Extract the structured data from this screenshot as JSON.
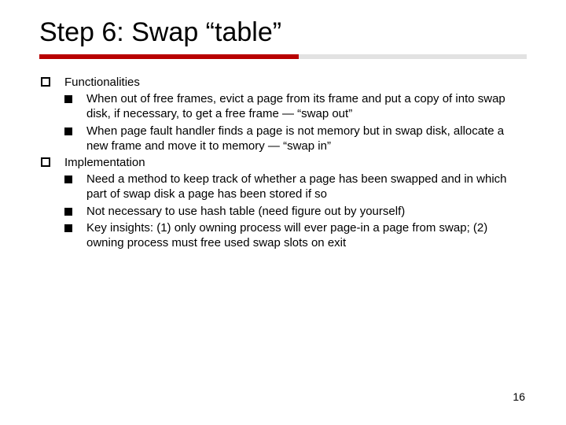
{
  "title": "Step 6: Swap “table”",
  "sections": [
    {
      "heading": "Functionalities",
      "items": [
        "When out of free frames, evict a page from its frame and put a copy of into swap disk, if necessary, to get a free frame — “swap out”",
        "When page fault handler finds a page is not memory but in swap disk, allocate a new frame and move it to memory  — “swap in”"
      ]
    },
    {
      "heading": "Implementation",
      "items": [
        "Need a method to keep track of whether a page has been swapped and in which part of swap disk a page has been stored if so",
        "Not necessary to use hash table (need figure out by yourself)",
        "Key insights: (1) only owning process will ever page-in a page from swap; (2) owning process must free used swap slots on exit"
      ]
    }
  ],
  "page_number": "16"
}
